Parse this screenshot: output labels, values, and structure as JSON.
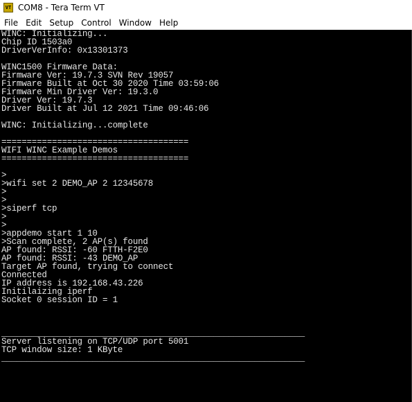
{
  "window": {
    "app_icon_text": "VT",
    "title": "COM8 - Tera Term VT"
  },
  "menu": [
    "File",
    "Edit",
    "Setup",
    "Control",
    "Window",
    "Help"
  ],
  "terminal": {
    "lines": [
      "WINC: Initializing...",
      "Chip ID 1503a0",
      "DriverVerInfo: 0x13301373",
      "",
      "WINC1500 Firmware Data:",
      "Firmware Ver: 19.7.3 SVN Rev 19057",
      "Firmware Built at Oct 30 2020 Time 03:59:06",
      "Firmware Min Driver Ver: 19.3.0",
      "Driver Ver: 19.7.3",
      "Driver Built at Jul 12 2021 Time 09:46:06",
      "",
      "WINC: Initializing...complete",
      "",
      "=====================================",
      "WIFI WINC Example Demos",
      "=====================================",
      "",
      ">",
      ">wifi set 2 DEMO_AP 2 12345678",
      ">",
      ">",
      ">siperf tcp",
      ">",
      ">",
      ">appdemo start 1 10",
      ">Scan complete, 2 AP(s) found",
      "AP found: RSSI: -60 FTTH-F2E0",
      "AP found: RSSI: -43 DEMO_AP",
      "Target AP found, trying to connect",
      "Connected",
      "IP address is 192.168.43.226",
      "Initilaizing iperf",
      "Socket 0 session ID = 1",
      "",
      "",
      "",
      "____________________________________________________________",
      "Server listening on TCP/UDP port 5001",
      "TCP window size: 1 KByte",
      "____________________________________________________________"
    ]
  }
}
